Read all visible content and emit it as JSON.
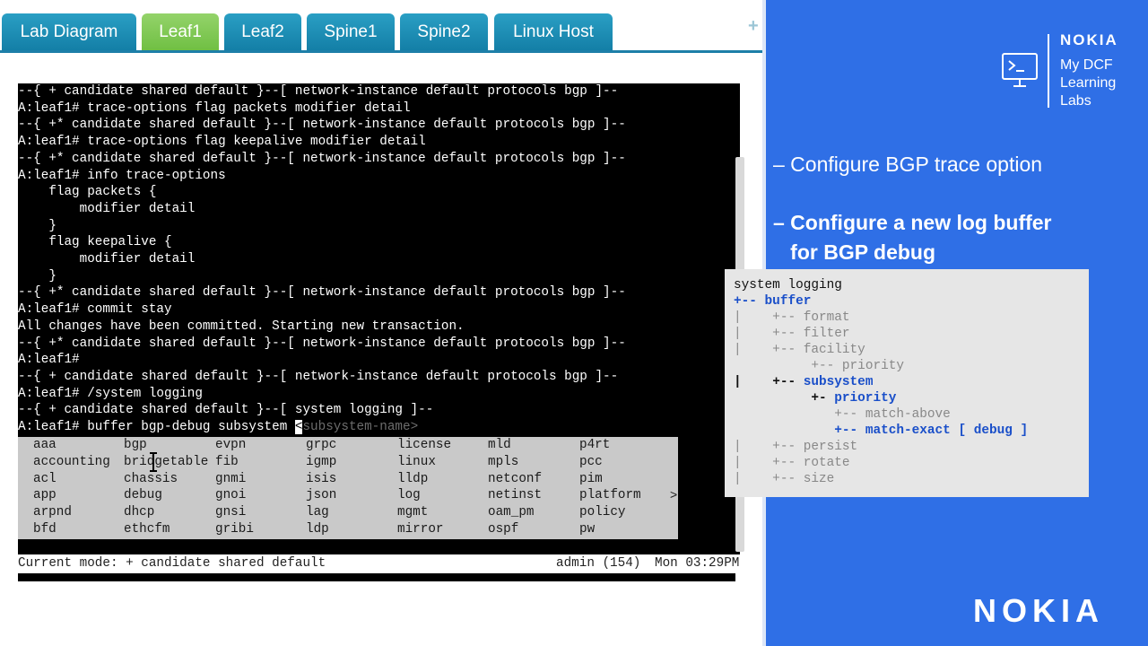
{
  "tabs": [
    {
      "label": "Lab Diagram",
      "active": false
    },
    {
      "label": "Leaf1",
      "active": true
    },
    {
      "label": "Leaf2",
      "active": false
    },
    {
      "label": "Spine1",
      "active": false
    },
    {
      "label": "Spine2",
      "active": false
    },
    {
      "label": "Linux Host",
      "active": false
    }
  ],
  "new_tab_label": "+",
  "terminal": {
    "lines": [
      "--{ + candidate shared default }--[ network-instance default protocols bgp ]--",
      "A:leaf1# trace-options flag packets modifier detail",
      "--{ +* candidate shared default }--[ network-instance default protocols bgp ]--",
      "A:leaf1# trace-options flag keepalive modifier detail",
      "--{ +* candidate shared default }--[ network-instance default protocols bgp ]--",
      "A:leaf1# info trace-options",
      "    flag packets {",
      "        modifier detail",
      "    }",
      "    flag keepalive {",
      "        modifier detail",
      "    }",
      "--{ +* candidate shared default }--[ network-instance default protocols bgp ]--",
      "A:leaf1# commit stay",
      "All changes have been committed. Starting new transaction.",
      "--{ +* candidate shared default }--[ network-instance default protocols bgp ]--",
      "A:leaf1#",
      "--{ + candidate shared default }--[ network-instance default protocols bgp ]--",
      "A:leaf1# /system logging",
      "--{ + candidate shared default }--[ system logging ]--"
    ],
    "prompt_line": "A:leaf1# buffer bgp-debug subsystem ",
    "cursor_char": "<",
    "hint_text": "subsystem-name>",
    "completions": [
      [
        "aaa",
        "bgp",
        "evpn",
        "grpc",
        "license",
        "mld",
        "p4rt"
      ],
      [
        "accounting",
        "bridgetable",
        "fib",
        "igmp",
        "linux",
        "mpls",
        "pcc"
      ],
      [
        "acl",
        "chassis",
        "gnmi",
        "isis",
        "lldp",
        "netconf",
        "pim"
      ],
      [
        "app",
        "debug",
        "gnoi",
        "json",
        "log",
        "netinst",
        "platform"
      ],
      [
        "arpnd",
        "dhcp",
        "gnsi",
        "lag",
        "mgmt",
        "oam_pm",
        "policy"
      ],
      [
        "bfd",
        "ethcfm",
        "gribi",
        "ldp",
        "mirror",
        "ospf",
        "pw"
      ]
    ],
    "more_indicator": ">",
    "status_mode": "Current mode: + candidate shared default",
    "status_user": "admin (154)",
    "status_time": "Mon 03:29PM"
  },
  "brand": {
    "nokia_wordmark": "NOKIA",
    "lines": [
      "My DCF",
      "Learning",
      "Labs"
    ],
    "icon": "terminal-monitor-icon"
  },
  "bullets": [
    {
      "text": "– Configure BGP trace option",
      "bold": false
    },
    {
      "text": "– Configure a new log buffer",
      "bold": true
    },
    {
      "text": "   for BGP debug",
      "bold": true
    }
  ],
  "tree": {
    "root": "system logging",
    "buffer": "buffer",
    "format": "format",
    "filter": "filter",
    "facility": "facility",
    "facility_priority": "priority",
    "subsystem": "subsystem",
    "subsystem_priority": "priority",
    "match_above": "match-above",
    "match_exact": "match-exact [ debug ]",
    "persist": "persist",
    "rotate": "rotate",
    "size": "size"
  },
  "footer_logo": "NOKIA",
  "colors": {
    "panel_blue": "#2f6fe6",
    "tab_blue": "#1e8ab4",
    "tab_active": "#79c54b",
    "tree_blue": "#1a4fc9"
  }
}
